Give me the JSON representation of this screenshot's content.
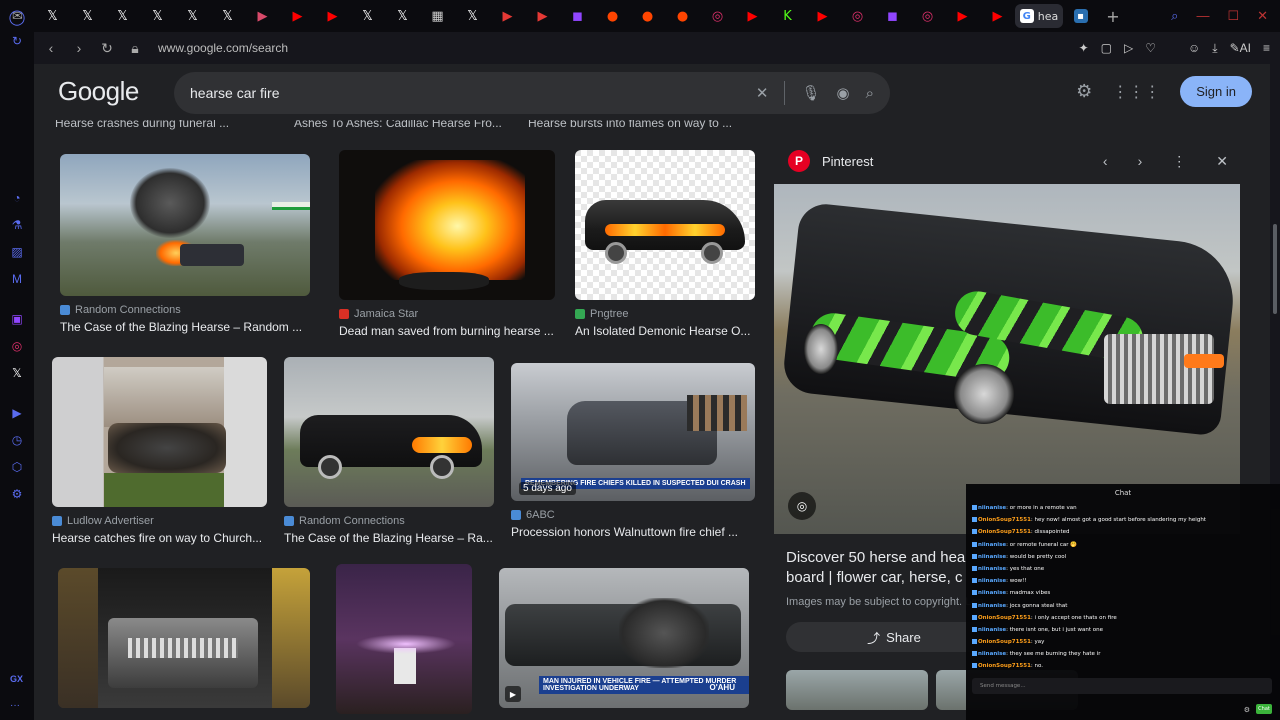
{
  "browser": {
    "url": "www.google.com/search",
    "active_tab_title": "hea",
    "sidebar_bottom": "GX"
  },
  "tabs": [
    {
      "icon": "mail-icon",
      "glyph": "✉",
      "color": "#aaaaaa"
    },
    {
      "icon": "x-icon",
      "glyph": "𝕏",
      "color": "#ffffff"
    },
    {
      "icon": "x-icon",
      "glyph": "𝕏",
      "color": "#ffffff"
    },
    {
      "icon": "x-icon",
      "glyph": "𝕏",
      "color": "#ffffff"
    },
    {
      "icon": "x-icon",
      "glyph": "𝕏",
      "color": "#ffffff"
    },
    {
      "icon": "x-icon",
      "glyph": "𝕏",
      "color": "#ffffff"
    },
    {
      "icon": "x-icon",
      "glyph": "𝕏",
      "color": "#ffffff"
    },
    {
      "icon": "mixed-icon",
      "glyph": "▶",
      "color": "#d84a6a"
    },
    {
      "icon": "youtube-icon",
      "glyph": "▶",
      "color": "#ff0000"
    },
    {
      "icon": "youtube-icon",
      "glyph": "▶",
      "color": "#ff0000"
    },
    {
      "icon": "x-icon",
      "glyph": "𝕏",
      "color": "#ffffff"
    },
    {
      "icon": "x-icon",
      "glyph": "𝕏",
      "color": "#ffffff"
    },
    {
      "icon": "news-icon",
      "glyph": "▦",
      "color": "#cccccc"
    },
    {
      "icon": "x-icon",
      "glyph": "𝕏",
      "color": "#ffffff"
    },
    {
      "icon": "flipboard-icon",
      "glyph": "▶",
      "color": "#e53935"
    },
    {
      "icon": "flipboard-icon",
      "glyph": "▶",
      "color": "#e53935"
    },
    {
      "icon": "twitch-icon",
      "glyph": "◼",
      "color": "#9146ff"
    },
    {
      "icon": "reddit-icon",
      "glyph": "●",
      "color": "#ff4500"
    },
    {
      "icon": "reddit-icon",
      "glyph": "●",
      "color": "#ff4500"
    },
    {
      "icon": "reddit-icon",
      "glyph": "●",
      "color": "#ff4500"
    },
    {
      "icon": "instagram-icon",
      "glyph": "◎",
      "color": "#e1306c"
    },
    {
      "icon": "youtube-icon",
      "glyph": "▶",
      "color": "#ff0000"
    },
    {
      "icon": "kick-icon",
      "glyph": "K",
      "color": "#53fc18"
    },
    {
      "icon": "youtube-icon",
      "glyph": "▶",
      "color": "#ff0000"
    },
    {
      "icon": "instagram-icon",
      "glyph": "◎",
      "color": "#e1306c"
    },
    {
      "icon": "twitch-icon",
      "glyph": "◼",
      "color": "#9146ff"
    },
    {
      "icon": "instagram-icon",
      "glyph": "◎",
      "color": "#e1306c"
    },
    {
      "icon": "youtube-icon",
      "glyph": "▶",
      "color": "#ff0000"
    },
    {
      "icon": "youtube-icon",
      "glyph": "▶",
      "color": "#ff0000"
    }
  ],
  "google": {
    "logo": "Google",
    "query": "hearse car fire",
    "sign_in": "Sign in",
    "cut_titles": [
      "Hearse crashes during funeral ...",
      "Ashes To Ashes: Cadillac Hearse Fro...",
      "Hearse bursts into flames on way to ..."
    ]
  },
  "results": [
    {
      "source": "Random Connections",
      "title": "The Case of the Blazing Hearse – Random ...",
      "favicon": "#4a8bd6"
    },
    {
      "source": "Jamaica Star",
      "title": "Dead man saved from burning hearse ...",
      "favicon": "#d93025"
    },
    {
      "source": "Pngtree",
      "title": "An Isolated Demonic Hearse O...",
      "favicon": "#34a853"
    },
    {
      "source": "Ludlow Advertiser",
      "title": "Hearse catches fire on way to Church...",
      "favicon": "#4a8bd6"
    },
    {
      "source": "Random Connections",
      "title": "The Case of the Blazing Hearse – Ra...",
      "favicon": "#4a8bd6"
    },
    {
      "source": "6ABC",
      "title": "Procession honors Walnuttown fire chief ...",
      "favicon": "#4a8bd6",
      "age": "5 days ago",
      "banner": "REMEMBERING FIRE CHIEFS KILLED IN SUSPECTED DUI CRASH"
    },
    {
      "banner": "MAN INJURED IN VEHICLE FIRE — ATTEMPTED MURDER INVESTIGATION UNDERWAY",
      "station": "O'AHU"
    }
  ],
  "preview": {
    "site": "Pinterest",
    "title_line1": "Discover 50 herse and hea",
    "title_line2": "board | flower car, herse, c",
    "copyright": "Images may be subject to copyright. Lea",
    "share": "Share"
  },
  "chat": {
    "header": "Chat",
    "placeholder": "Send message...",
    "send": "Chat",
    "messages": [
      {
        "user": "niinanise",
        "text": "or more in a remote van",
        "color": "#59a8ff"
      },
      {
        "user": "OnionSoup71551",
        "text": "hey now! almost got a good start before slandering my height",
        "color": "#ff9f1a"
      },
      {
        "user": "OnionSoup71551",
        "text": "dissapointed",
        "color": "#ff9f1a"
      },
      {
        "user": "niinanise",
        "text": "or remote funeral car 🤭",
        "color": "#59a8ff"
      },
      {
        "user": "niinanise",
        "text": "would be pretty cool",
        "color": "#59a8ff"
      },
      {
        "user": "niinanise",
        "text": "yes that one",
        "color": "#59a8ff"
      },
      {
        "user": "niinanise",
        "text": "wow!!",
        "color": "#59a8ff"
      },
      {
        "user": "niinanise",
        "text": "madmax vibes",
        "color": "#59a8ff"
      },
      {
        "user": "niinanise",
        "text": "jocs gonna steal that",
        "color": "#59a8ff"
      },
      {
        "user": "OnionSoup71551",
        "text": "i only accept one thats on fire",
        "color": "#ff9f1a"
      },
      {
        "user": "niinanise",
        "text": "there isnt one, but i just want one",
        "color": "#59a8ff"
      },
      {
        "user": "OnionSoup71551",
        "text": "yay",
        "color": "#ff9f1a"
      },
      {
        "user": "niinanise",
        "text": "they see me burning they hate ir",
        "color": "#59a8ff"
      },
      {
        "user": "OnionSoup71551",
        "text": "no.",
        "color": "#ff9f1a"
      }
    ]
  }
}
